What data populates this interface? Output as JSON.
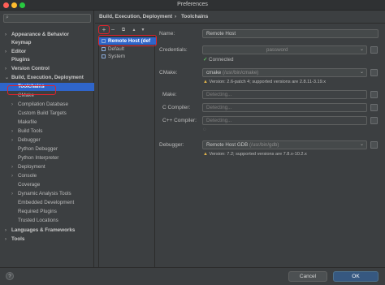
{
  "window": {
    "title": "Preferences"
  },
  "search": {
    "placeholder": ""
  },
  "sidebar": {
    "items": [
      {
        "label": "Appearance & Behavior",
        "arrow": "›",
        "bold": true
      },
      {
        "label": "Keymap",
        "arrow": "",
        "bold": true
      },
      {
        "label": "Editor",
        "arrow": "›",
        "bold": true
      },
      {
        "label": "Plugins",
        "arrow": "",
        "bold": true
      },
      {
        "label": "Version Control",
        "arrow": "›",
        "bold": true
      },
      {
        "label": "Build, Execution, Deployment",
        "arrow": "⌄",
        "bold": true
      },
      {
        "label": "Toolchains",
        "arrow": "",
        "bold": true
      },
      {
        "label": "CMake",
        "arrow": ""
      },
      {
        "label": "Compilation Database",
        "arrow": "›"
      },
      {
        "label": "Custom Build Targets",
        "arrow": ""
      },
      {
        "label": "Makefile",
        "arrow": ""
      },
      {
        "label": "Build Tools",
        "arrow": "›"
      },
      {
        "label": "Debugger",
        "arrow": "›"
      },
      {
        "label": "Python Debugger",
        "arrow": ""
      },
      {
        "label": "Python Interpreter",
        "arrow": ""
      },
      {
        "label": "Deployment",
        "arrow": "›"
      },
      {
        "label": "Console",
        "arrow": "›"
      },
      {
        "label": "Coverage",
        "arrow": ""
      },
      {
        "label": "Dynamic Analysis Tools",
        "arrow": "›"
      },
      {
        "label": "Embedded Development",
        "arrow": ""
      },
      {
        "label": "Required Plugins",
        "arrow": ""
      },
      {
        "label": "Trusted Locations",
        "arrow": ""
      },
      {
        "label": "Languages & Frameworks",
        "arrow": "›",
        "bold": true
      },
      {
        "label": "Tools",
        "arrow": "›",
        "bold": true
      }
    ]
  },
  "header": {
    "crumb1": "Build, Execution, Deployment",
    "sep": "›",
    "crumb2": "Toolchains"
  },
  "toolbar": {
    "add": "+",
    "remove": "−",
    "copy": "⧉",
    "up": "▲",
    "down": "▼"
  },
  "toolchains": [
    {
      "label": "Remote Host (def"
    },
    {
      "label": "Default"
    },
    {
      "label": "System"
    }
  ],
  "form": {
    "name_label": "Name:",
    "name_value": "Remote Host",
    "credentials_label": "Credentials:",
    "credentials_placeholder": "password",
    "connected_icon": "✓",
    "connected_text": "Connected",
    "cmake_label": "CMake:",
    "cmake_value": "cmake",
    "cmake_path": "(/usr/bin/cmake)",
    "cmake_warning": "Version: 2.6-patch 4; supported versions are 2.8.11-3.19.x",
    "make_label": "Make:",
    "make_value": "Detecting...",
    "c_compiler_label": "C Compiler:",
    "c_compiler_value": "Detecting...",
    "cpp_compiler_label": "C++ Compiler:",
    "cpp_compiler_value": "Detecting...",
    "debugger_label": "Debugger:",
    "debugger_value": "Remote Host GDB",
    "debugger_path": "(/usr/bin/gdb)",
    "debugger_warning": "Version: 7.2; supported versions are 7.8.x-10.2.x"
  },
  "footer": {
    "help": "?",
    "cancel": "Cancel",
    "ok": "OK"
  },
  "colors": {
    "accent": "#2f65ca",
    "highlight": "#e0242d",
    "warning": "#e0b34a",
    "success": "#5fb760"
  }
}
